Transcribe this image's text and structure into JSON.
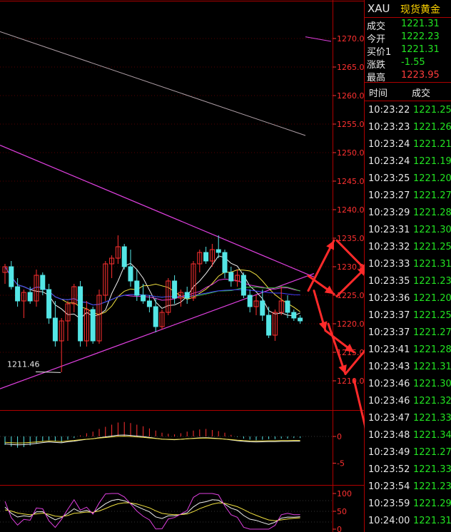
{
  "colors": {
    "background": "#000000",
    "grid_red": "#b00000",
    "axis_red": "#ff3030",
    "up_candle": "#ff3030",
    "down_candle": "#54e6e6",
    "price_green": "#22e322",
    "name_yellow": "#ffd400",
    "trend_magenta": "#e040e0",
    "ma_blue": "#4040ff",
    "annotation_red": "#ff2a2a"
  },
  "header": {
    "symbol": "XAU",
    "name": "现货黄金"
  },
  "quote": [
    {
      "key": "成交",
      "value": "1221.31",
      "color": "green"
    },
    {
      "key": "今开",
      "value": "1222.23",
      "color": "green"
    },
    {
      "key": "买价1",
      "value": "1221.31",
      "color": "green"
    },
    {
      "key": "涨跌",
      "value": "-1.55",
      "color": "green"
    },
    {
      "key": "最高",
      "value": "1223.95",
      "color": "red"
    }
  ],
  "ticks_header": {
    "time": "时间",
    "price": "成交"
  },
  "ticks": [
    {
      "time": "10:23:22",
      "price": "1221.25"
    },
    {
      "time": "10:23:23",
      "price": "1221.26"
    },
    {
      "time": "10:23:24",
      "price": "1221.21"
    },
    {
      "time": "10:23:24",
      "price": "1221.19"
    },
    {
      "time": "10:23:25",
      "price": "1221.20"
    },
    {
      "time": "10:23:27",
      "price": "1221.27"
    },
    {
      "time": "10:23:29",
      "price": "1221.28"
    },
    {
      "time": "10:23:31",
      "price": "1221.30"
    },
    {
      "time": "10:23:32",
      "price": "1221.25"
    },
    {
      "time": "10:23:33",
      "price": "1221.31"
    },
    {
      "time": "10:23:35",
      "price": "1221.23"
    },
    {
      "time": "10:23:36",
      "price": "1221.20"
    },
    {
      "time": "10:23:37",
      "price": "1221.25"
    },
    {
      "time": "10:23:37",
      "price": "1221.27"
    },
    {
      "time": "10:23:41",
      "price": "1221.28"
    },
    {
      "time": "10:23:43",
      "price": "1221.31"
    },
    {
      "time": "10:23:46",
      "price": "1221.30"
    },
    {
      "time": "10:23:46",
      "price": "1221.32"
    },
    {
      "time": "10:23:47",
      "price": "1221.33"
    },
    {
      "time": "10:23:48",
      "price": "1221.34"
    },
    {
      "time": "10:23:49",
      "price": "1221.27"
    },
    {
      "time": "10:23:52",
      "price": "1221.33"
    },
    {
      "time": "10:23:54",
      "price": "1221.23"
    },
    {
      "time": "10:23:59",
      "price": "1221.29"
    },
    {
      "time": "10:24:00",
      "price": "1221.31"
    }
  ],
  "chart_data": [
    {
      "type": "candlestick",
      "yticks": [
        1210.0,
        1215.0,
        1220.0,
        1225.0,
        1230.0,
        1235.0,
        1240.0,
        1245.0,
        1250.0,
        1255.0,
        1260.0,
        1265.0,
        1270.0
      ],
      "ylim": [
        1207,
        1272
      ],
      "annotations": [
        {
          "text": "1211.46",
          "price": 1211.46
        }
      ],
      "candles": [
        {
          "o": 1229.0,
          "h": 1230.5,
          "l": 1227.0,
          "c": 1230.0
        },
        {
          "o": 1230.0,
          "h": 1231.0,
          "l": 1226.0,
          "c": 1226.5
        },
        {
          "o": 1226.5,
          "h": 1228.0,
          "l": 1223.0,
          "c": 1224.0
        },
        {
          "o": 1224.0,
          "h": 1226.0,
          "l": 1221.0,
          "c": 1225.5
        },
        {
          "o": 1225.5,
          "h": 1226.5,
          "l": 1223.5,
          "c": 1224.0
        },
        {
          "o": 1224.0,
          "h": 1229.5,
          "l": 1223.0,
          "c": 1228.5
        },
        {
          "o": 1228.5,
          "h": 1229.0,
          "l": 1225.0,
          "c": 1226.0
        },
        {
          "o": 1226.0,
          "h": 1227.0,
          "l": 1220.0,
          "c": 1221.0
        },
        {
          "o": 1221.0,
          "h": 1224.0,
          "l": 1216.0,
          "c": 1217.0
        },
        {
          "o": 1217.0,
          "h": 1221.0,
          "l": 1211.5,
          "c": 1220.5
        },
        {
          "o": 1220.5,
          "h": 1224.0,
          "l": 1217.0,
          "c": 1223.5
        },
        {
          "o": 1223.5,
          "h": 1227.0,
          "l": 1222.0,
          "c": 1226.5
        },
        {
          "o": 1226.5,
          "h": 1227.5,
          "l": 1216.0,
          "c": 1217.0
        },
        {
          "o": 1217.0,
          "h": 1224.0,
          "l": 1216.0,
          "c": 1222.5
        },
        {
          "o": 1222.5,
          "h": 1223.0,
          "l": 1216.5,
          "c": 1217.0
        },
        {
          "o": 1217.0,
          "h": 1226.0,
          "l": 1216.5,
          "c": 1225.0
        },
        {
          "o": 1225.0,
          "h": 1231.0,
          "l": 1224.0,
          "c": 1230.5
        },
        {
          "o": 1230.5,
          "h": 1232.0,
          "l": 1228.0,
          "c": 1231.5
        },
        {
          "o": 1231.5,
          "h": 1235.5,
          "l": 1230.5,
          "c": 1233.5
        },
        {
          "o": 1233.5,
          "h": 1234.0,
          "l": 1229.5,
          "c": 1230.0
        },
        {
          "o": 1230.0,
          "h": 1233.0,
          "l": 1226.5,
          "c": 1227.5
        },
        {
          "o": 1227.5,
          "h": 1229.5,
          "l": 1224.0,
          "c": 1225.0
        },
        {
          "o": 1225.0,
          "h": 1227.0,
          "l": 1223.5,
          "c": 1224.0
        },
        {
          "o": 1224.0,
          "h": 1225.0,
          "l": 1222.0,
          "c": 1223.0
        },
        {
          "o": 1223.0,
          "h": 1224.5,
          "l": 1218.5,
          "c": 1219.5
        },
        {
          "o": 1219.5,
          "h": 1222.5,
          "l": 1219.0,
          "c": 1222.0
        },
        {
          "o": 1222.0,
          "h": 1228.0,
          "l": 1221.5,
          "c": 1227.5
        },
        {
          "o": 1227.5,
          "h": 1228.5,
          "l": 1223.5,
          "c": 1224.5
        },
        {
          "o": 1224.5,
          "h": 1226.0,
          "l": 1223.0,
          "c": 1225.5
        },
        {
          "o": 1225.5,
          "h": 1226.5,
          "l": 1223.5,
          "c": 1224.5
        },
        {
          "o": 1224.5,
          "h": 1231.0,
          "l": 1224.0,
          "c": 1230.5
        },
        {
          "o": 1230.5,
          "h": 1233.0,
          "l": 1229.0,
          "c": 1232.5
        },
        {
          "o": 1232.5,
          "h": 1233.5,
          "l": 1230.5,
          "c": 1231.0
        },
        {
          "o": 1231.0,
          "h": 1234.0,
          "l": 1230.0,
          "c": 1233.0
        },
        {
          "o": 1233.0,
          "h": 1235.5,
          "l": 1231.5,
          "c": 1232.5
        },
        {
          "o": 1232.5,
          "h": 1233.0,
          "l": 1228.0,
          "c": 1229.0
        },
        {
          "o": 1229.0,
          "h": 1230.0,
          "l": 1226.5,
          "c": 1227.5
        },
        {
          "o": 1227.5,
          "h": 1229.5,
          "l": 1226.5,
          "c": 1228.5
        },
        {
          "o": 1228.5,
          "h": 1229.0,
          "l": 1224.5,
          "c": 1225.0
        },
        {
          "o": 1225.0,
          "h": 1226.0,
          "l": 1222.0,
          "c": 1223.0
        },
        {
          "o": 1223.0,
          "h": 1225.0,
          "l": 1221.5,
          "c": 1224.0
        },
        {
          "o": 1224.0,
          "h": 1226.0,
          "l": 1220.5,
          "c": 1221.5
        },
        {
          "o": 1221.5,
          "h": 1223.0,
          "l": 1217.5,
          "c": 1218.0
        },
        {
          "o": 1218.0,
          "h": 1222.5,
          "l": 1217.0,
          "c": 1222.0
        },
        {
          "o": 1222.0,
          "h": 1226.5,
          "l": 1221.5,
          "c": 1224.0
        },
        {
          "o": 1224.0,
          "h": 1225.0,
          "l": 1221.0,
          "c": 1222.0
        },
        {
          "o": 1222.0,
          "h": 1222.5,
          "l": 1220.5,
          "c": 1221.0
        },
        {
          "o": 1221.0,
          "h": 1221.5,
          "l": 1220.0,
          "c": 1220.5
        }
      ]
    },
    {
      "type": "bar",
      "panel": "MACD",
      "yticks": [
        0,
        -5
      ],
      "values": [
        -1.6,
        -1.9,
        -2.1,
        -2.0,
        -1.7,
        -1.4,
        -1.0,
        -0.7,
        -0.9,
        -1.1,
        -0.6,
        -0.3,
        0.2,
        0.6,
        0.9,
        1.4,
        1.8,
        2.2,
        2.6,
        2.7,
        2.5,
        2.2,
        1.9,
        1.5,
        1.1,
        0.7,
        0.5,
        0.4,
        0.6,
        0.9,
        1.1,
        1.3,
        1.4,
        1.2,
        1.0,
        0.7,
        0.3,
        -0.1,
        -0.4,
        -0.6,
        -0.7,
        -0.6,
        -0.5,
        -0.5,
        -0.4,
        -0.4,
        -0.3,
        -0.3
      ]
    },
    {
      "type": "line",
      "panel": "KDJ",
      "yticks": [
        100,
        50,
        0
      ]
    }
  ]
}
